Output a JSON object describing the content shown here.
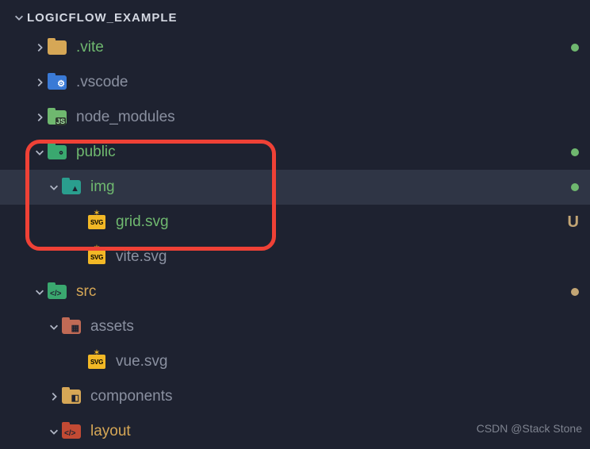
{
  "header": {
    "title": "LOGICFLOW_EXAMPLE"
  },
  "tree": {
    "vite": {
      "label": ".vite"
    },
    "vscode": {
      "label": ".vscode"
    },
    "node_modules": {
      "label": "node_modules"
    },
    "public": {
      "label": "public"
    },
    "img": {
      "label": "img"
    },
    "grid_svg": {
      "label": "grid.svg",
      "status": "U"
    },
    "vite_svg": {
      "label": "vite.svg"
    },
    "src": {
      "label": "src"
    },
    "assets": {
      "label": "assets"
    },
    "vue_svg": {
      "label": "vue.svg"
    },
    "components": {
      "label": "components"
    },
    "layout": {
      "label": "layout"
    }
  },
  "watermark": "CSDN @Stack Stone"
}
